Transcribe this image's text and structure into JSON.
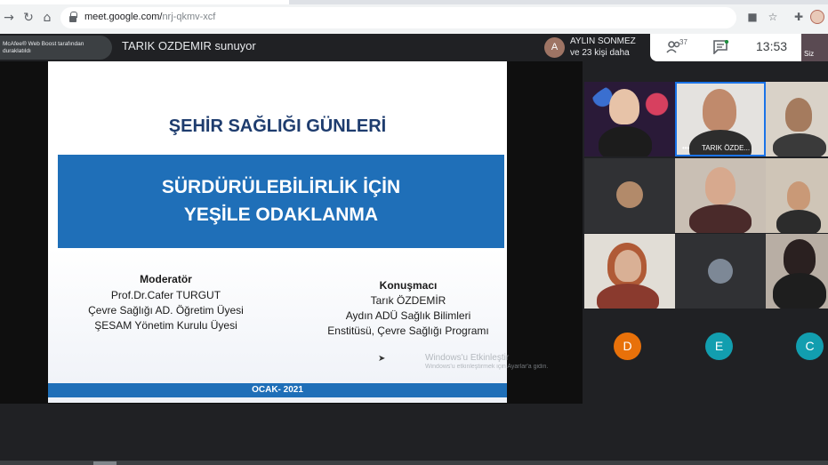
{
  "browser": {
    "url_host": "meet.google.com/",
    "url_path": "nrj-qkmv-xcf"
  },
  "meet": {
    "mcafee_notice": "McAfee® Web Boost tarafından duraklatıldı",
    "presenter_label": "TARIK OZDEMIR sunuyor",
    "active_speaker_initial": "A",
    "active_speaker_name": "AYLIN SONMEZ",
    "others_count": "ve 23 kişi daha",
    "participants_count": "37",
    "time": "13:53",
    "self_label": "Siz",
    "pinned_tile_name": "TARIK ÖZDE..."
  },
  "slide": {
    "title": "ŞEHİR SAĞLIĞI GÜNLERİ",
    "band_line1": "SÜRDÜRÜLEBİLİRLİK İÇİN",
    "band_line2": "YEŞİLE ODAKLANMA",
    "moderator_heading": "Moderatör",
    "moderator_line1": "Prof.Dr.Cafer TURGUT",
    "moderator_line2": "Çevre Sağlığı AD. Öğretim Üyesi",
    "moderator_line3": "ŞESAM Yönetim Kurulu Üyesi",
    "speaker_heading": "Konuşmacı",
    "speaker_line1": "Tarık ÖZDEMİR",
    "speaker_line2": "Aydın ADÜ Sağlık Bilimleri",
    "speaker_line3": "Enstitüsü, Çevre Sağlığı Programı",
    "footer": "OCAK- 2021"
  },
  "windows_watermark": {
    "line1": "Windows'u Etkinleştir",
    "line2": "Windows'u etkinleştirmek için Ayarlar'a gidin."
  },
  "avatars": [
    {
      "letter": "D",
      "color": "#e8710a"
    },
    {
      "letter": "E",
      "color": "#129eaf"
    },
    {
      "letter": "C",
      "color": "#129eaf"
    }
  ]
}
